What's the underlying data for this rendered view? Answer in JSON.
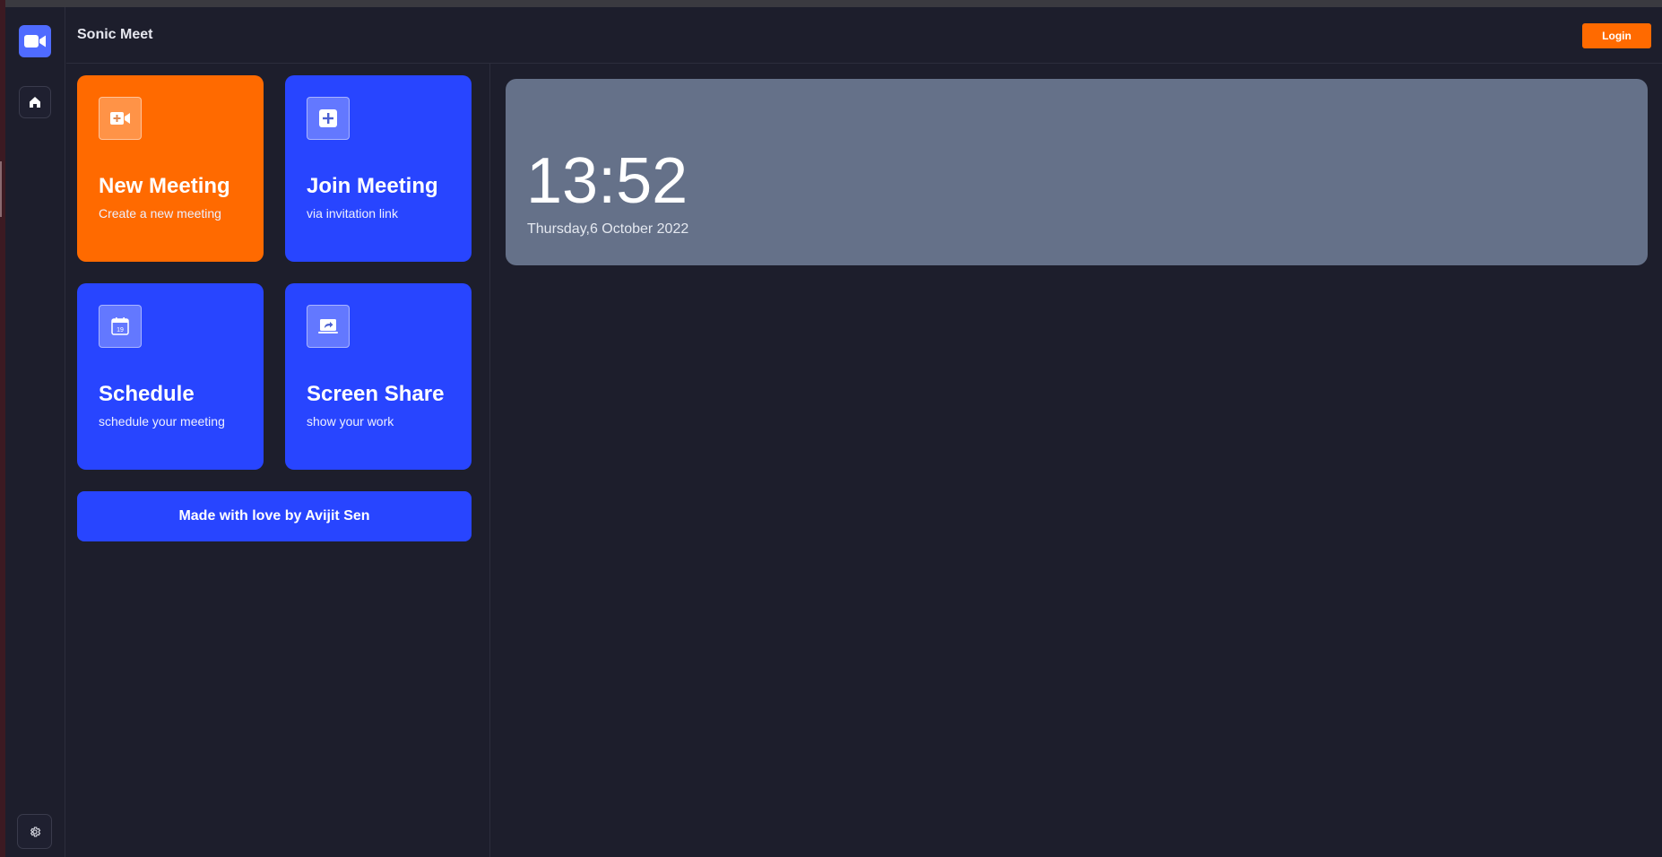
{
  "app": {
    "title": "Sonic Meet"
  },
  "header": {
    "login_label": "Login"
  },
  "sidebar": {
    "items": [
      {
        "icon": "video-camera-icon"
      },
      {
        "icon": "home-icon"
      },
      {
        "icon": "gear-icon"
      }
    ]
  },
  "cards": [
    {
      "title": "New Meeting",
      "subtitle": "Create a new meeting",
      "icon": "video-plus-icon",
      "color": "#ff6a00"
    },
    {
      "title": "Join Meeting",
      "subtitle": "via invitation link",
      "icon": "plus-square-icon",
      "color": "#2845ff"
    },
    {
      "title": "Schedule",
      "subtitle": "schedule your meeting",
      "icon": "calendar-icon",
      "color": "#2845ff"
    },
    {
      "title": "Screen Share",
      "subtitle": "show your work",
      "icon": "screen-share-icon",
      "color": "#2845ff"
    }
  ],
  "calendar_icon_day": "19",
  "footer": {
    "label": "Made with love by Avijit Sen"
  },
  "clock": {
    "time": "13:52",
    "date": "Thursday,6 October 2022"
  },
  "colors": {
    "accent_orange": "#ff6a00",
    "accent_blue": "#2845ff",
    "background": "#1d1e2c",
    "clock_panel": "#657189"
  }
}
